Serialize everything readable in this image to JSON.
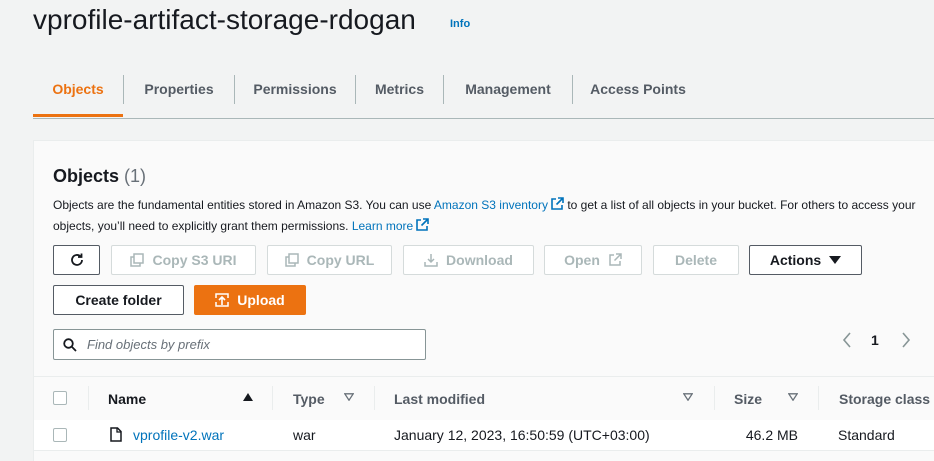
{
  "bucket": {
    "name": "vprofile-artifact-storage-rdogan",
    "info_label": "Info"
  },
  "tabs": [
    {
      "label": "Objects",
      "active": true
    },
    {
      "label": "Properties"
    },
    {
      "label": "Permissions"
    },
    {
      "label": "Metrics"
    },
    {
      "label": "Management"
    },
    {
      "label": "Access Points"
    }
  ],
  "objects_panel": {
    "title": "Objects",
    "count": "(1)",
    "description": {
      "part1": "Objects are the fundamental entities stored in Amazon S3. You can use ",
      "inventory_link": "Amazon S3 inventory",
      "part2": " to get a list of all objects in your bucket. For others to access your",
      "part3": "objects, you’ll need to explicitly grant them permissions. ",
      "learn_more": "Learn more"
    }
  },
  "toolbar": {
    "refresh_label": "",
    "copy_s3_uri": "Copy S3 URI",
    "copy_url": "Copy URL",
    "download": "Download",
    "open": "Open",
    "delete": "Delete",
    "actions": "Actions",
    "create_folder": "Create folder",
    "upload": "Upload"
  },
  "search": {
    "placeholder": "Find objects by prefix",
    "value": ""
  },
  "pagination": {
    "page": "1"
  },
  "table": {
    "columns": [
      "Name",
      "Type",
      "Last modified",
      "Size",
      "Storage class"
    ],
    "rows": [
      {
        "name": "vprofile-v2.war",
        "type": "war",
        "last_modified": "January 12, 2023, 16:50:59 (UTC+03:00)",
        "size": "46.2 MB",
        "storage_class": "Standard"
      }
    ]
  },
  "colors": {
    "accent": "#ec7211",
    "link": "#0073bb",
    "text": "#16191f",
    "muted": "#545b64",
    "disabled": "#aab7b8"
  }
}
